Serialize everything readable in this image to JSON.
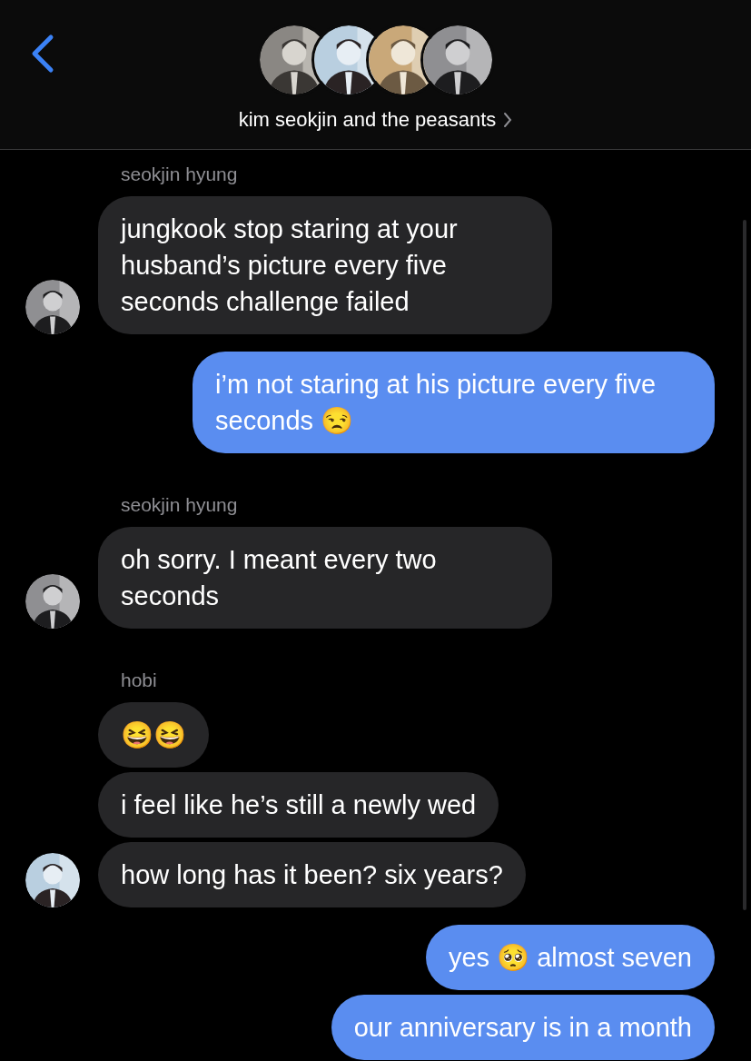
{
  "header": {
    "title": "kim seokjin and the peasants"
  },
  "conversation": [
    {
      "kind": "incoming",
      "sender": "seokjin hyung",
      "bubbles": [
        "jungkook stop staring at your husband’s picture every five seconds challenge failed"
      ]
    },
    {
      "kind": "outgoing",
      "bubbles": [
        "i’m not staring at his picture every five seconds 😒"
      ]
    },
    {
      "kind": "incoming",
      "sender": "seokjin hyung",
      "bubbles": [
        "oh sorry. I meant every two seconds"
      ]
    },
    {
      "kind": "incoming",
      "sender": "hobi",
      "bubbles": [
        "😆😆",
        "i feel like he’s still a newly wed",
        "how long has it been? six years?"
      ]
    },
    {
      "kind": "outgoing",
      "bubbles": [
        "yes 🥺 almost seven",
        "our anniversary is in a month"
      ]
    }
  ]
}
